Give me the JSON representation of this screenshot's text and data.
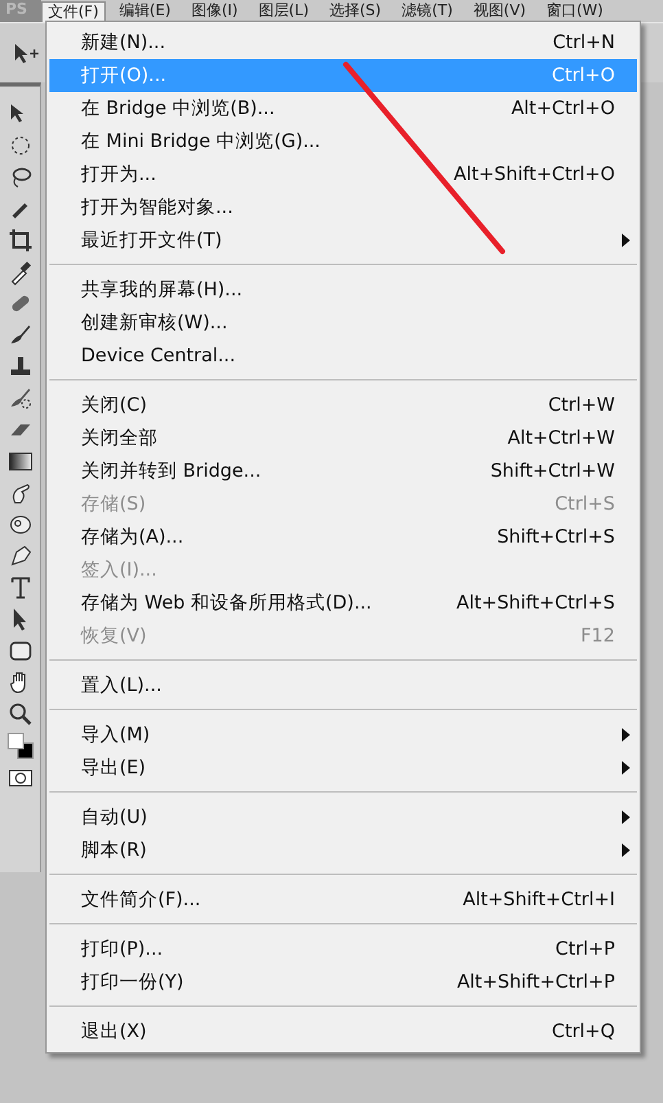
{
  "app": {
    "logo": "PS"
  },
  "menubar": [
    {
      "label": "文件(F)",
      "selected": true
    },
    {
      "label": "编辑(E)",
      "selected": false
    },
    {
      "label": "图像(I)",
      "selected": false
    },
    {
      "label": "图层(L)",
      "selected": false
    },
    {
      "label": "选择(S)",
      "selected": false
    },
    {
      "label": "滤镜(T)",
      "selected": false
    },
    {
      "label": "视图(V)",
      "selected": false
    },
    {
      "label": "窗口(W)",
      "selected": false
    }
  ],
  "menu": {
    "sections": [
      [
        {
          "label": "新建(N)...",
          "shortcut": "Ctrl+N",
          "selected": false,
          "disabled": false,
          "submenu": false
        },
        {
          "label": "打开(O)...",
          "shortcut": "Ctrl+O",
          "selected": true,
          "disabled": false,
          "submenu": false
        },
        {
          "label": "在 Bridge 中浏览(B)...",
          "shortcut": "Alt+Ctrl+O",
          "selected": false,
          "disabled": false,
          "submenu": false
        },
        {
          "label": "在 Mini Bridge 中浏览(G)...",
          "selected": false,
          "disabled": false,
          "submenu": false
        },
        {
          "label": "打开为...",
          "shortcut": "Alt+Shift+Ctrl+O",
          "selected": false,
          "disabled": false,
          "submenu": false
        },
        {
          "label": "打开为智能对象...",
          "selected": false,
          "disabled": false,
          "submenu": false
        },
        {
          "label": "最近打开文件(T)",
          "selected": false,
          "disabled": false,
          "submenu": true
        }
      ],
      [
        {
          "label": "共享我的屏幕(H)...",
          "selected": false,
          "disabled": false,
          "submenu": false
        },
        {
          "label": "创建新审核(W)...",
          "selected": false,
          "disabled": false,
          "submenu": false
        },
        {
          "label": "Device Central...",
          "selected": false,
          "disabled": false,
          "submenu": false
        }
      ],
      [
        {
          "label": "关闭(C)",
          "shortcut": "Ctrl+W",
          "selected": false,
          "disabled": false,
          "submenu": false
        },
        {
          "label": "关闭全部",
          "shortcut": "Alt+Ctrl+W",
          "selected": false,
          "disabled": false,
          "submenu": false
        },
        {
          "label": "关闭并转到 Bridge...",
          "shortcut": "Shift+Ctrl+W",
          "selected": false,
          "disabled": false,
          "submenu": false
        },
        {
          "label": "存储(S)",
          "shortcut": "Ctrl+S",
          "selected": false,
          "disabled": true,
          "submenu": false
        },
        {
          "label": "存储为(A)...",
          "shortcut": "Shift+Ctrl+S",
          "selected": false,
          "disabled": false,
          "submenu": false
        },
        {
          "label": "签入(I)...",
          "selected": false,
          "disabled": true,
          "submenu": false
        },
        {
          "label": "存储为 Web 和设备所用格式(D)...",
          "shortcut": "Alt+Shift+Ctrl+S",
          "selected": false,
          "disabled": false,
          "submenu": false
        },
        {
          "label": "恢复(V)",
          "shortcut": "F12",
          "selected": false,
          "disabled": true,
          "submenu": false
        }
      ],
      [
        {
          "label": "置入(L)...",
          "selected": false,
          "disabled": false,
          "submenu": false
        }
      ],
      [
        {
          "label": "导入(M)",
          "selected": false,
          "disabled": false,
          "submenu": true
        },
        {
          "label": "导出(E)",
          "selected": false,
          "disabled": false,
          "submenu": true
        }
      ],
      [
        {
          "label": "自动(U)",
          "selected": false,
          "disabled": false,
          "submenu": true
        },
        {
          "label": "脚本(R)",
          "selected": false,
          "disabled": false,
          "submenu": true
        }
      ],
      [
        {
          "label": "文件简介(F)...",
          "shortcut": "Alt+Shift+Ctrl+I",
          "selected": false,
          "disabled": false,
          "submenu": false
        }
      ],
      [
        {
          "label": "打印(P)...",
          "shortcut": "Ctrl+P",
          "selected": false,
          "disabled": false,
          "submenu": false
        },
        {
          "label": "打印一份(Y)",
          "shortcut": "Alt+Shift+Ctrl+P",
          "selected": false,
          "disabled": false,
          "submenu": false
        }
      ],
      [
        {
          "label": "退出(X)",
          "shortcut": "Ctrl+Q",
          "selected": false,
          "disabled": false,
          "submenu": false
        }
      ]
    ]
  }
}
